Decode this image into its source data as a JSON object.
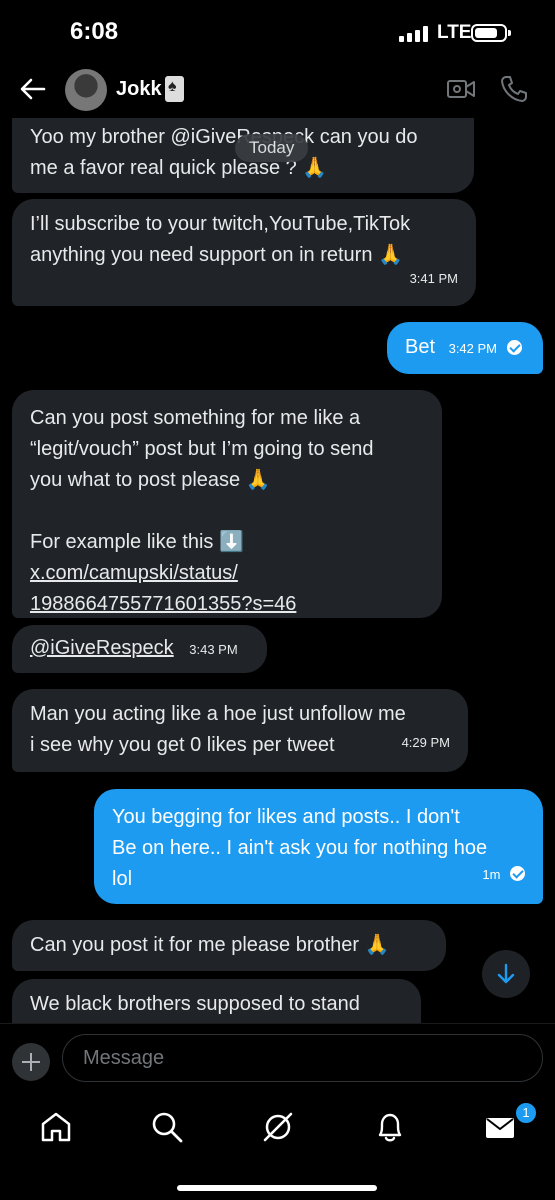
{
  "status_bar": {
    "time": "6:08",
    "network": "LTE"
  },
  "header": {
    "name": "Jokk"
  },
  "chat": {
    "date_separator": "Today",
    "messages": [
      {
        "from": "them",
        "lines": [
          "Yoo my brother @iGiveRespeck can you do",
          "me a favor real quick please ? 🙏"
        ],
        "time": ""
      },
      {
        "from": "them",
        "lines": [
          "I’ll subscribe to your twitch,YouTube,TikTok",
          "anything you need support on in return 🙏"
        ],
        "time": "3:41 PM"
      },
      {
        "from": "me",
        "text": "Bet",
        "time": "3:42 PM"
      },
      {
        "from": "them",
        "lines": [
          "Can you post something for me like a",
          "“legit/vouch” post but I’m going to send",
          "you what to post please 🙏",
          "",
          "For example like this ⬇️"
        ],
        "link_lines": [
          "x.com/camupski/status/",
          "1988664755771601355?s=46"
        ],
        "time": ""
      },
      {
        "from": "them",
        "mention": "@iGiveRespeck",
        "time": "3:43 PM"
      },
      {
        "from": "them",
        "lines": [
          "Man you acting like a hoe just unfollow me",
          "i see why you get 0 likes per tweet"
        ],
        "time": "4:29 PM"
      },
      {
        "from": "me",
        "lines": [
          "You begging for likes and posts.. I don't",
          "Be on here.. I ain't ask you for nothing hoe",
          "lol"
        ],
        "time": "1m"
      },
      {
        "from": "them",
        "text": "Can you post it for me please brother 🙏"
      },
      {
        "from": "them",
        "text": "We black brothers supposed to stand"
      }
    ]
  },
  "composer": {
    "placeholder": "Message"
  },
  "tabbar": {
    "messages_badge": "1"
  },
  "icons": {
    "back": "arrow-left-icon",
    "video": "video-call-icon",
    "phone": "phone-icon",
    "home": "home-icon",
    "search": "search-icon",
    "grok": "grok-icon",
    "notifications": "bell-icon",
    "messages": "envelope-icon",
    "scroll_down": "arrow-down-icon",
    "add": "plus-icon"
  },
  "colors": {
    "accent": "#1d9bf0",
    "incoming_bubble": "#202327",
    "background": "#000000"
  }
}
